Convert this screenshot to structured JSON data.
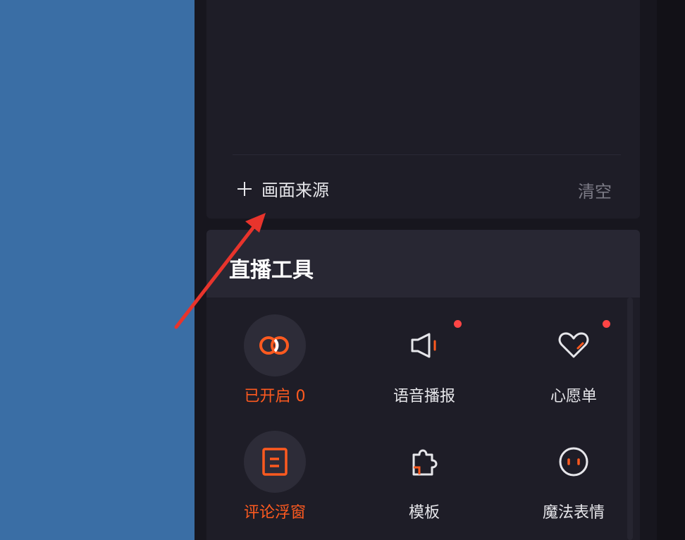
{
  "source_panel": {
    "add_label": "画面来源",
    "clear_label": "清空"
  },
  "tools": {
    "title": "直播工具",
    "items": [
      {
        "label": "已开启 0",
        "icon": "link-rings-icon",
        "active": true,
        "dot": false
      },
      {
        "label": "语音播报",
        "icon": "megaphone-icon",
        "active": false,
        "dot": true
      },
      {
        "label": "心愿单",
        "icon": "heart-icon",
        "active": false,
        "dot": true
      },
      {
        "label": "评论浮窗",
        "icon": "comment-window-icon",
        "active": true,
        "dot": false
      },
      {
        "label": "模板",
        "icon": "puzzle-icon",
        "active": false,
        "dot": false
      },
      {
        "label": "魔法表情",
        "icon": "face-icon",
        "active": false,
        "dot": false
      }
    ]
  },
  "colors": {
    "accent": "#ff5a1f",
    "dot": "#ff4545",
    "panel": "#1e1d27",
    "desktop": "#3a6ea5"
  }
}
